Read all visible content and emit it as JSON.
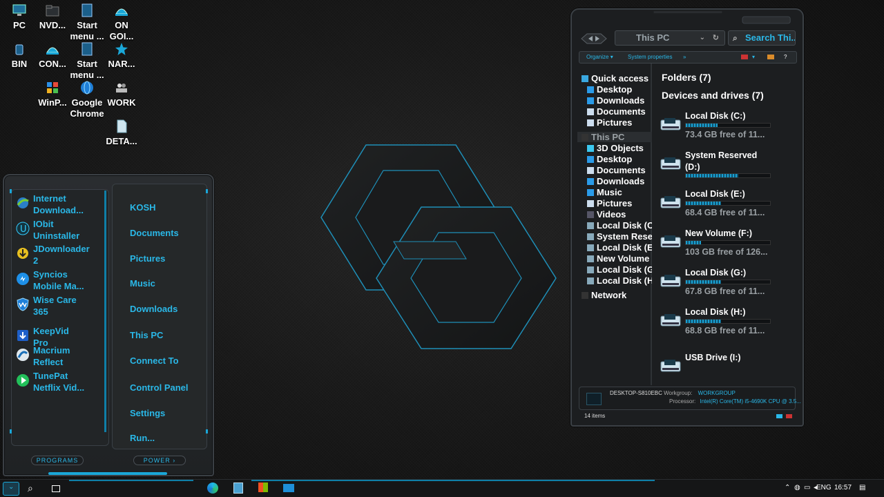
{
  "desktop_icons": [
    {
      "label": "PC",
      "icon": "monitor-icon"
    },
    {
      "label": "NVD...",
      "icon": "folder-icon"
    },
    {
      "label": "Start menu ...",
      "icon": "app-icon"
    },
    {
      "label": "ON GOI...",
      "icon": "hardhat-icon"
    },
    {
      "label": "BIN",
      "icon": "recycle-bin-icon"
    },
    {
      "label": "CON...",
      "icon": "hardhat-icon"
    },
    {
      "label": "Start menu ...",
      "icon": "app-icon"
    },
    {
      "label": "NAR...",
      "icon": "star-icon"
    },
    {
      "label": "WinP...",
      "icon": "windows-icon"
    },
    {
      "label": "Google Chrome",
      "icon": "globe-icon"
    },
    {
      "label": "WORK",
      "icon": "tools-icon"
    },
    {
      "label": "DETA...",
      "icon": "document-icon"
    }
  ],
  "start_menu": {
    "programs": [
      {
        "label": "Internet Download...",
        "icon": "idm-icon"
      },
      {
        "label": "IObit Uninstaller",
        "icon": "uninstaller-icon"
      },
      {
        "label": "JDownloader 2",
        "icon": "jdownloader-icon"
      },
      {
        "label": "Syncios Mobile Ma...",
        "icon": "syncios-icon"
      },
      {
        "label": "Wise Care 365",
        "icon": "shield-icon"
      },
      {
        "label": "KeepVid Pro",
        "icon": "download-icon"
      },
      {
        "label": "Macrium Reflect",
        "icon": "macrium-icon"
      },
      {
        "label": "TunePat Netflix Vid...",
        "icon": "play-icon"
      }
    ],
    "places": [
      "KOSH",
      "Documents",
      "Pictures",
      "Music",
      "Downloads",
      "This PC",
      "Connect To",
      "Control Panel",
      "Settings",
      "Run..."
    ],
    "programs_button": "PROGRAMS",
    "power_button": "POWER"
  },
  "explorer": {
    "address": "This PC",
    "search_placeholder": "Search Thi...",
    "toolbar": {
      "organize": "Organize",
      "system_properties": "System properties",
      "more": "»"
    },
    "nav": [
      {
        "label": "Quick access",
        "icon": "star-icon",
        "pinned": false
      },
      {
        "label": "Desktop",
        "icon": "desktop-icon",
        "pinned": true
      },
      {
        "label": "Downloads",
        "icon": "download-arrow-icon",
        "pinned": true
      },
      {
        "label": "Documents",
        "icon": "document-icon",
        "pinned": true
      },
      {
        "label": "Pictures",
        "icon": "picture-icon",
        "pinned": true
      },
      {
        "label": "This PC",
        "icon": "monitor-icon",
        "pinned": false
      },
      {
        "label": "3D Objects",
        "icon": "cube-icon",
        "pinned": false
      },
      {
        "label": "Desktop",
        "icon": "desktop-icon",
        "pinned": false
      },
      {
        "label": "Documents",
        "icon": "document-icon",
        "pinned": false
      },
      {
        "label": "Downloads",
        "icon": "download-arrow-icon",
        "pinned": false
      },
      {
        "label": "Music",
        "icon": "music-icon",
        "pinned": false
      },
      {
        "label": "Pictures",
        "icon": "picture-icon",
        "pinned": false
      },
      {
        "label": "Videos",
        "icon": "video-icon",
        "pinned": false
      },
      {
        "label": "Local Disk (C:)",
        "icon": "drive-icon",
        "pinned": false
      },
      {
        "label": "System Reserved (D:)",
        "icon": "drive-icon",
        "pinned": false
      },
      {
        "label": "Local Disk (E:)",
        "icon": "drive-icon",
        "pinned": false
      },
      {
        "label": "New Volume (F:)",
        "icon": "drive-icon",
        "pinned": false
      },
      {
        "label": "Local Disk (G:)",
        "icon": "drive-icon",
        "pinned": false
      },
      {
        "label": "Local Disk (H:)",
        "icon": "drive-icon",
        "pinned": false
      },
      {
        "label": "Network",
        "icon": "network-icon",
        "pinned": false
      }
    ],
    "folders_header": "Folders (7)",
    "drives_header": "Devices and drives (7)",
    "drives": [
      {
        "name": "Local Disk (C:)",
        "free": "73.4 GB free of 11...",
        "fill": 0.38
      },
      {
        "name": "System Reserved (D:)",
        "free": "",
        "fill": 0.62
      },
      {
        "name": "Local Disk (E:)",
        "free": "68.4 GB free of 11...",
        "fill": 0.42
      },
      {
        "name": "New Volume (F:)",
        "free": "103 GB free of 126...",
        "fill": 0.18
      },
      {
        "name": "Local Disk (G:)",
        "free": "67.8 GB free of 11...",
        "fill": 0.42
      },
      {
        "name": "Local Disk (H:)",
        "free": "68.8 GB free of 11...",
        "fill": 0.42
      },
      {
        "name": "USB Drive (I:)",
        "free": "",
        "fill": null
      }
    ],
    "details": {
      "computer": "DESKTOP-S810EBC",
      "workgroup_label": "Workgroup:",
      "workgroup": "WORKGROUP",
      "processor_label": "Processor:",
      "processor": "Intel(R) Core(TM) i5-4690K CPU @ 3.5..."
    },
    "status": "14 items"
  },
  "taskbar": {
    "language": "ENG",
    "time": "16:57"
  },
  "colors": {
    "accent": "#2ab8e8",
    "panel": "#1c1e20",
    "border": "#3b4045"
  }
}
